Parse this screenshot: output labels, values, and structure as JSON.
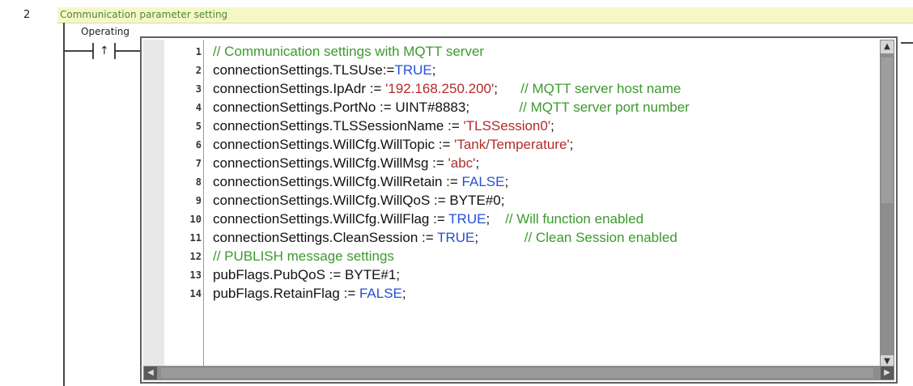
{
  "rung": {
    "number": "2",
    "title": "Communication parameter setting"
  },
  "contact": {
    "label": "Operating",
    "symbol": "↑"
  },
  "editor": {
    "lines": [
      {
        "number": "1",
        "tokens": [
          {
            "t": "// Communication settings with MQTT server",
            "k": "comment"
          }
        ]
      },
      {
        "number": "2",
        "tokens": [
          {
            "t": "connectionSettings.TLSUse:=",
            "k": "text"
          },
          {
            "t": "TRUE",
            "k": "keyword"
          },
          {
            "t": ";",
            "k": "text"
          }
        ]
      },
      {
        "number": "3",
        "tokens": [
          {
            "t": "connectionSettings.IpAdr := ",
            "k": "text"
          },
          {
            "t": "'192.168.250.200'",
            "k": "string"
          },
          {
            "t": ";      ",
            "k": "text"
          },
          {
            "t": "// MQTT server host name",
            "k": "comment"
          }
        ]
      },
      {
        "number": "4",
        "tokens": [
          {
            "t": "connectionSettings.PortNo := UINT#8883;             ",
            "k": "text"
          },
          {
            "t": "// MQTT server port number",
            "k": "comment"
          }
        ]
      },
      {
        "number": "5",
        "tokens": [
          {
            "t": "connectionSettings.TLSSessionName := ",
            "k": "text"
          },
          {
            "t": "'TLSSession0'",
            "k": "string"
          },
          {
            "t": ";",
            "k": "text"
          }
        ]
      },
      {
        "number": "6",
        "tokens": [
          {
            "t": "connectionSettings.WillCfg.WillTopic := ",
            "k": "text"
          },
          {
            "t": "'Tank/Temperature'",
            "k": "string"
          },
          {
            "t": ";",
            "k": "text"
          }
        ]
      },
      {
        "number": "7",
        "tokens": [
          {
            "t": "connectionSettings.WillCfg.WillMsg := ",
            "k": "text"
          },
          {
            "t": "'abc'",
            "k": "string"
          },
          {
            "t": ";",
            "k": "text"
          }
        ]
      },
      {
        "number": "8",
        "tokens": [
          {
            "t": "connectionSettings.WillCfg.WillRetain := ",
            "k": "text"
          },
          {
            "t": "FALSE",
            "k": "keyword"
          },
          {
            "t": ";",
            "k": "text"
          }
        ]
      },
      {
        "number": "9",
        "tokens": [
          {
            "t": "connectionSettings.WillCfg.WillQoS := BYTE#0;",
            "k": "text"
          }
        ]
      },
      {
        "number": "10",
        "tokens": [
          {
            "t": "connectionSettings.WillCfg.WillFlag := ",
            "k": "text"
          },
          {
            "t": "TRUE",
            "k": "keyword"
          },
          {
            "t": ";    ",
            "k": "text"
          },
          {
            "t": "// Will function enabled",
            "k": "comment"
          }
        ]
      },
      {
        "number": "11",
        "tokens": [
          {
            "t": "connectionSettings.CleanSession := ",
            "k": "text"
          },
          {
            "t": "TRUE",
            "k": "keyword"
          },
          {
            "t": ";            ",
            "k": "text"
          },
          {
            "t": "// Clean Session enabled",
            "k": "comment"
          }
        ]
      },
      {
        "number": "12",
        "tokens": [
          {
            "t": "// PUBLISH message settings",
            "k": "comment"
          }
        ]
      },
      {
        "number": "13",
        "tokens": [
          {
            "t": "pubFlags.PubQoS := BYTE#1;",
            "k": "text"
          }
        ]
      },
      {
        "number": "14",
        "tokens": [
          {
            "t": "pubFlags.RetainFlag := ",
            "k": "text"
          },
          {
            "t": "FALSE",
            "k": "keyword"
          },
          {
            "t": ";",
            "k": "text"
          }
        ]
      }
    ]
  },
  "colors": {
    "comment": "#3c9a2d",
    "keyword": "#2450d6",
    "string": "#b32a2a",
    "title_bar": "#f6f7c9"
  }
}
